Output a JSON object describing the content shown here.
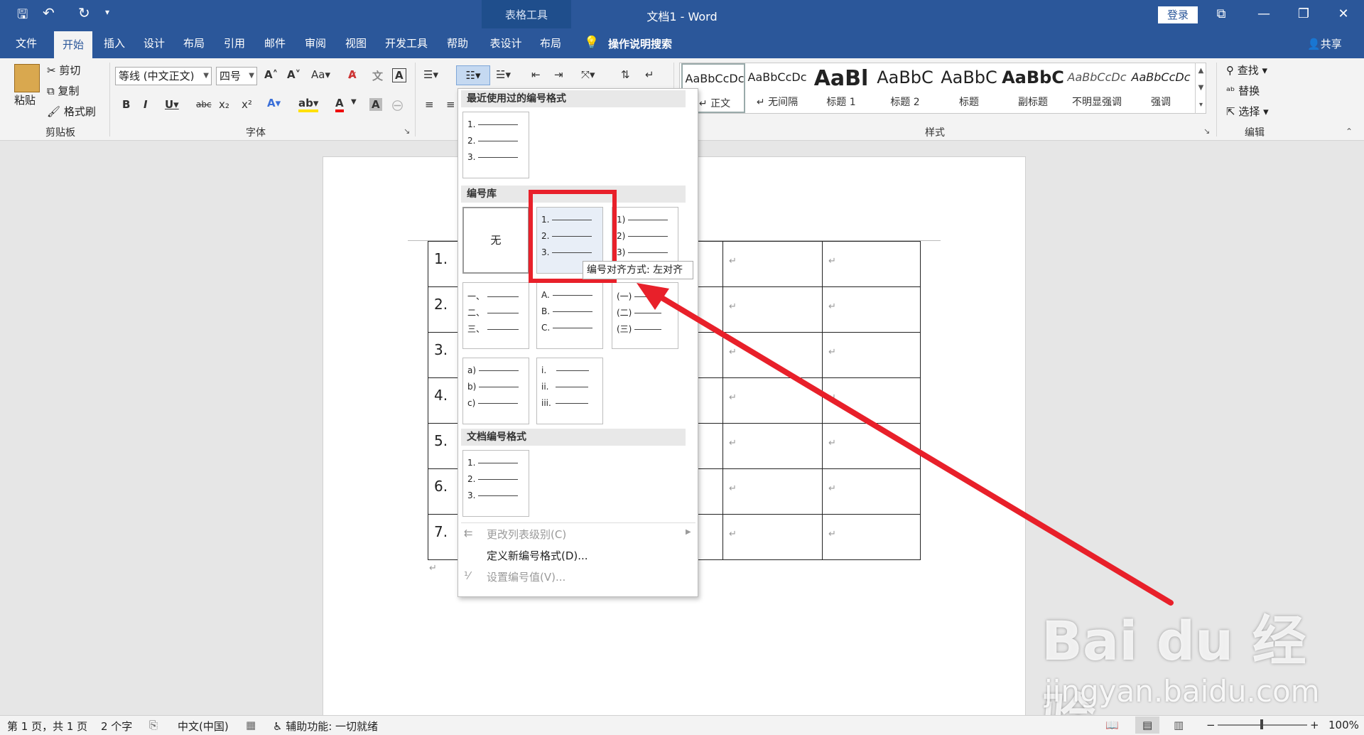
{
  "titlebar": {
    "contextual": "表格工具",
    "title": "文档1 - Word",
    "login": "登录"
  },
  "tabs": [
    "文件",
    "开始",
    "插入",
    "设计",
    "布局",
    "引用",
    "邮件",
    "审阅",
    "视图",
    "开发工具",
    "帮助",
    "表设计",
    "布局"
  ],
  "tell_me": "操作说明搜索",
  "share": "共享",
  "clipboard": {
    "paste": "粘贴",
    "cut": "剪切",
    "copy": "复制",
    "format_painter": "格式刷",
    "label": "剪贴板"
  },
  "font": {
    "name": "等线 (中文正文)",
    "size": "四号",
    "label": "字体"
  },
  "styles": {
    "label": "样式",
    "items": [
      {
        "sample": "AaBbCcDc",
        "name": "↵ 正文"
      },
      {
        "sample": "AaBbCcDc",
        "name": "↵ 无间隔"
      },
      {
        "sample": "AaBl",
        "name": "标题 1"
      },
      {
        "sample": "AaBbC",
        "name": "标题 2"
      },
      {
        "sample": "AaBbC",
        "name": "标题"
      },
      {
        "sample": "AaBbC",
        "name": "副标题"
      },
      {
        "sample": "AaBbCcDc",
        "name": "不明显强调"
      },
      {
        "sample": "AaBbCcDc",
        "name": "强调"
      }
    ]
  },
  "editing": {
    "find": "查找",
    "replace": "替换",
    "select": "选择",
    "label": "编辑"
  },
  "numbering_dropdown": {
    "recent_header": "最近使用过的编号格式",
    "library_header": "编号库",
    "doc_header": "文档编号格式",
    "none": "无",
    "formats": {
      "decimal": [
        "1.",
        "2.",
        "3."
      ],
      "paren": [
        "1)",
        "2)",
        "3)"
      ],
      "chinese": [
        "一、",
        "二、",
        "三、"
      ],
      "upper": [
        "A.",
        "B.",
        "C."
      ],
      "chinese_paren": [
        "(一)",
        "(二)",
        "(三)"
      ],
      "lower_paren": [
        "a)",
        "b)",
        "c)"
      ],
      "roman": [
        "i.",
        "ii.",
        "iii."
      ]
    },
    "menu": [
      "更改列表级别(C)",
      "定义新编号格式(D)...",
      "设置编号值(V)..."
    ],
    "tooltip": "编号对齐方式: 左对齐"
  },
  "table": {
    "numbers": [
      "1.",
      "2.",
      "3.",
      "4.",
      "5.",
      "6.",
      "7."
    ]
  },
  "status": {
    "page": "第 1 页，共 1 页",
    "words": "2 个字",
    "lang": "中文(中国)",
    "accessibility": "辅助功能: 一切就绪",
    "zoom": "100%"
  },
  "watermark": {
    "brand": "Bai du 经验",
    "url": "jingyan.baidu.com"
  },
  "colors": {
    "titlebar": "#2b579a",
    "highlight": "#e8202a",
    "arrow": "#e8202a"
  }
}
